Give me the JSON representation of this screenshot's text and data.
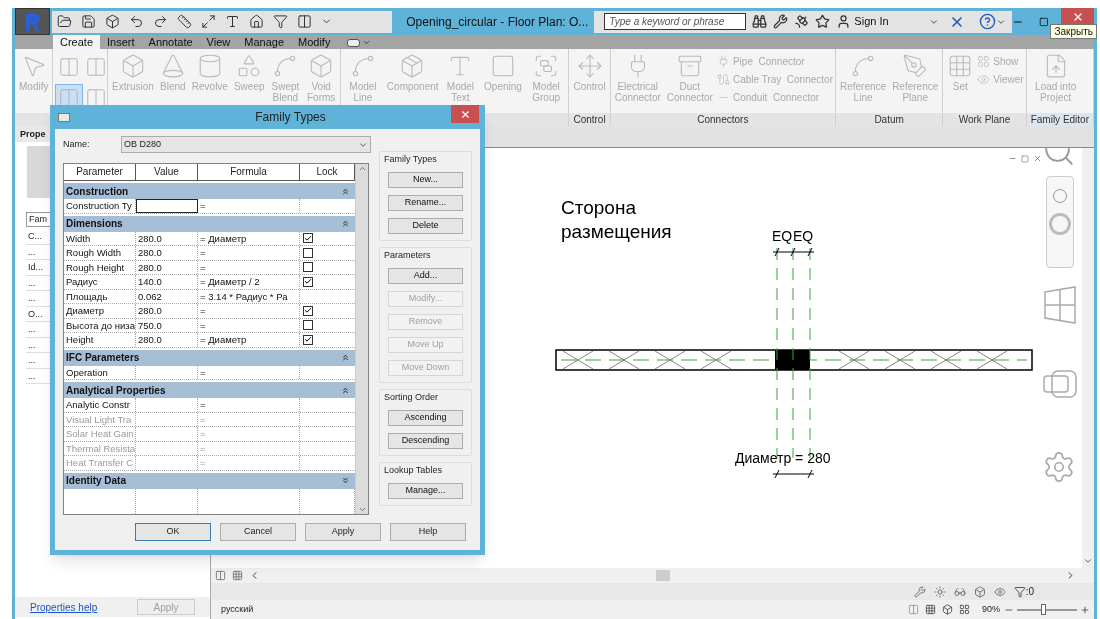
{
  "title_bar": {
    "title": "Opening_circular - Floor Plan: O...",
    "search": {
      "placeholder": "Type a keyword or phrase"
    },
    "sign_in": "Sign In",
    "tooltip": "Закрыть"
  },
  "ribbon": {
    "tabs": [
      {
        "label": "Create",
        "selected": true
      },
      {
        "label": "Insert",
        "selected": false
      },
      {
        "label": "Annotate",
        "selected": false
      },
      {
        "label": "View",
        "selected": false
      },
      {
        "label": "Manage",
        "selected": false
      },
      {
        "label": "Modify",
        "selected": false
      }
    ],
    "panels": [
      {
        "buttons": [
          {
            "kind": "large",
            "label": "Modify",
            "selected": false
          }
        ]
      },
      {
        "buttons": [
          {
            "kind": "icon",
            "selected": false
          },
          {
            "kind": "icon",
            "selected": false
          },
          {
            "kind": "icon",
            "selected": true
          },
          {
            "kind": "icon",
            "selected": false
          }
        ]
      },
      {
        "buttons": [
          {
            "kind": "large",
            "label": "Extrusion",
            "selected": false
          },
          {
            "kind": "large",
            "label": "Blend",
            "selected": false
          },
          {
            "kind": "large",
            "label": "Revolve",
            "selected": false
          },
          {
            "kind": "large",
            "label": "Sweep",
            "selected": false
          },
          {
            "kind": "large",
            "label": "Swept Blend",
            "selected": false
          },
          {
            "kind": "large",
            "label": "Void Forms",
            "selected": false
          }
        ]
      },
      {
        "buttons": [
          {
            "kind": "large",
            "label": "Model Line",
            "selected": false
          },
          {
            "kind": "large",
            "label": "Component",
            "selected": false
          },
          {
            "kind": "large",
            "label": "Model Text",
            "selected": false
          },
          {
            "kind": "large",
            "label": "Opening",
            "selected": false
          },
          {
            "kind": "large",
            "label": "Model Group",
            "selected": false
          }
        ]
      },
      {
        "label": "Control",
        "buttons": [
          {
            "kind": "large",
            "label": "Control",
            "selected": false
          }
        ]
      },
      {
        "label": "Connectors",
        "buttons": [
          {
            "kind": "large",
            "label": "Electrical Connector",
            "selected": false
          },
          {
            "kind": "large",
            "label": "Duct Connector",
            "selected": false
          },
          {
            "kind": "small",
            "label": "Pipe  Connector",
            "selected": false
          },
          {
            "kind": "small",
            "label": "Cable Tray  Connector",
            "selected": false
          },
          {
            "kind": "small",
            "label": "Conduit  Connector",
            "selected": false
          }
        ]
      },
      {
        "label": "Datum",
        "buttons": [
          {
            "kind": "large",
            "label": "Reference Line",
            "selected": false
          },
          {
            "kind": "large",
            "label": "Reference Plane",
            "selected": false
          }
        ]
      },
      {
        "label": "Work Plane",
        "buttons": [
          {
            "kind": "large",
            "label": "Set",
            "selected": false
          },
          {
            "kind": "small",
            "label": "Show",
            "selected": false
          },
          {
            "kind": "small",
            "label": "Viewer",
            "selected": false
          }
        ]
      },
      {
        "label": "Family Editor",
        "buttons": [
          {
            "kind": "large",
            "label": "Load into Project",
            "selected": false
          }
        ]
      }
    ]
  },
  "properties": {
    "title": "Prope",
    "type_row": "Fam",
    "rows": [
      "C...",
      "...",
      "Id...",
      "...",
      "...",
      "O...",
      "...",
      "...",
      "...",
      "..."
    ],
    "help_link": "Properties help",
    "apply": {
      "label": "Apply",
      "disabled": true
    }
  },
  "canvas": {
    "annotation": "Сторона размещения",
    "eq_labels": [
      "EQ",
      "EQ"
    ],
    "dimension": "Диаметр = 280"
  },
  "view_bar": {
    "filter_count": ":0"
  },
  "status_bar": {
    "language": "русский",
    "zoom": {
      "reading": "90%",
      "level": 0.45
    }
  },
  "dialog": {
    "title": "Family Types",
    "name_label": "Name:",
    "name_value": "OB D280",
    "columns": [
      "Parameter",
      "Value",
      "Formula",
      "Lock"
    ],
    "rows": [
      {
        "kind": "group",
        "label": "Construction",
        "expanded": true
      },
      {
        "kind": "param",
        "name": "Construction Ty",
        "formula": "=",
        "disabled": false,
        "editing": true
      },
      {
        "kind": "group",
        "label": "Dimensions",
        "expanded": true
      },
      {
        "kind": "param_lock",
        "name": "Width",
        "value": "280.0",
        "formula": "= Диаметр",
        "locked": true,
        "disabled": false,
        "editing": false
      },
      {
        "kind": "param_lock",
        "name": "Rough Width",
        "value": "280.0",
        "formula": "=",
        "locked": false,
        "disabled": false,
        "editing": false
      },
      {
        "kind": "param_lock",
        "name": "Rough Height",
        "value": "280.0",
        "formula": "=",
        "locked": false,
        "disabled": false,
        "editing": false
      },
      {
        "kind": "param_lock",
        "name": "Радиус",
        "value": "140.0",
        "formula": "= Диаметр / 2",
        "locked": true,
        "disabled": false,
        "editing": false
      },
      {
        "kind": "param",
        "name": "Площадь",
        "value": "0.062",
        "formula": "= 3.14 * Радиус * Ра",
        "disabled": false,
        "editing": false
      },
      {
        "kind": "param_lock",
        "name": "Диаметр",
        "value": "280.0",
        "formula": "=",
        "locked": true,
        "disabled": false,
        "editing": false
      },
      {
        "kind": "param_lock",
        "name": "Высота до низа",
        "value": "750.0",
        "formula": "=",
        "locked": false,
        "disabled": false,
        "editing": false
      },
      {
        "kind": "param_lock",
        "name": "Height",
        "value": "280.0",
        "formula": "= Диаметр",
        "locked": true,
        "disabled": false,
        "editing": false
      },
      {
        "kind": "group",
        "label": "IFC Parameters",
        "expanded": true
      },
      {
        "kind": "param",
        "name": "Operation",
        "formula": "=",
        "disabled": false,
        "editing": false
      },
      {
        "kind": "group",
        "label": "Analytical Properties",
        "expanded": true
      },
      {
        "kind": "param",
        "name": "Analytic Constr",
        "formula": "=",
        "disabled": false,
        "editing": false
      },
      {
        "kind": "param",
        "name": "Visual Light Tra",
        "formula": "=",
        "disabled": true,
        "editing": false
      },
      {
        "kind": "param",
        "name": "Solar Heat Gain",
        "formula": "=",
        "disabled": true,
        "editing": false
      },
      {
        "kind": "param",
        "name": "Thermal Resista",
        "formula": "=",
        "disabled": true,
        "editing": false
      },
      {
        "kind": "param",
        "name": "Heat Transfer C",
        "formula": "=",
        "disabled": true,
        "editing": false
      },
      {
        "kind": "group",
        "label": "Identity Data",
        "expanded": false
      }
    ],
    "side_groups": [
      {
        "label": "Family Types",
        "buttons": [
          {
            "label": "New...",
            "disabled": false
          },
          {
            "label": "Rename...",
            "disabled": false
          },
          {
            "label": "Delete",
            "disabled": false
          }
        ]
      },
      {
        "label": "Parameters",
        "buttons": [
          {
            "label": "Add...",
            "disabled": false
          },
          {
            "label": "Modify...",
            "disabled": true
          },
          {
            "label": "Remove",
            "disabled": true
          },
          {
            "label": "Move Up",
            "disabled": true
          },
          {
            "label": "Move Down",
            "disabled": true
          }
        ]
      },
      {
        "label": "Sorting Order",
        "buttons": [
          {
            "label": "Ascending",
            "disabled": false
          },
          {
            "label": "Descending",
            "disabled": false
          }
        ]
      },
      {
        "label": "Lookup Tables",
        "buttons": [
          {
            "label": "Manage...",
            "disabled": false
          }
        ]
      }
    ],
    "footer_buttons": [
      {
        "label": "OK",
        "default": true
      },
      {
        "label": "Cancel",
        "default": false
      },
      {
        "label": "Apply",
        "default": false
      },
      {
        "label": "Help",
        "default": false
      }
    ]
  }
}
